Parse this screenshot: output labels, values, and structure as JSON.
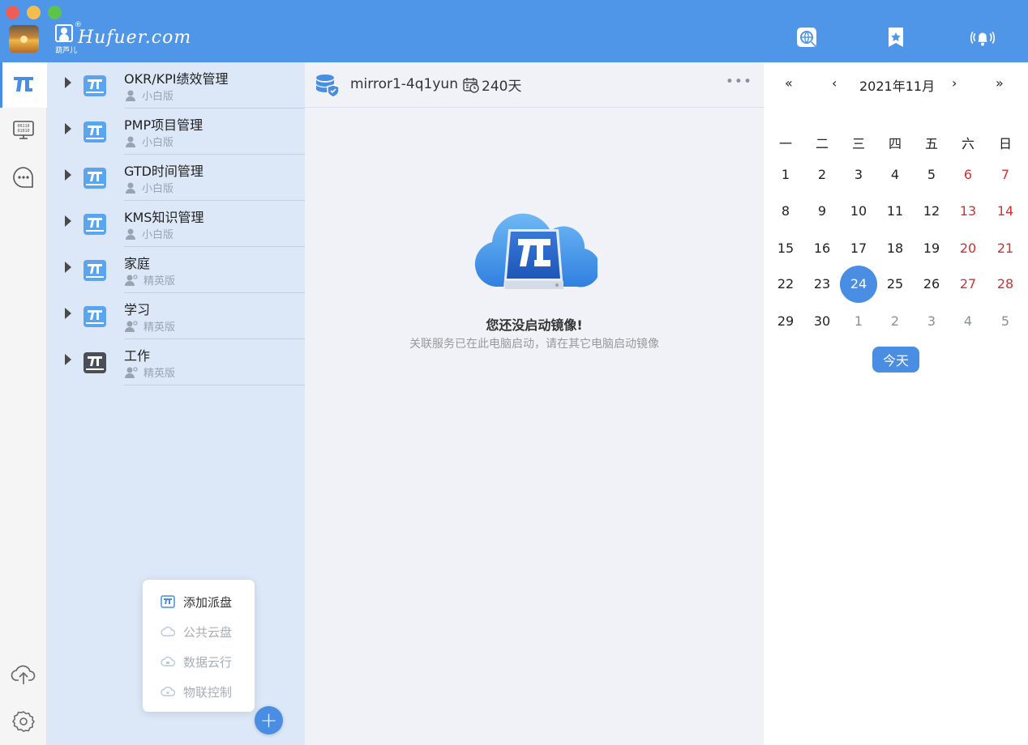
{
  "window": {
    "logo_text": "Hufuer.com",
    "logo_sub": "葫芦儿",
    "logo_reg": "®",
    "top_icons": [
      "globe-search-icon",
      "bookmark-star-icon",
      "bell-icon"
    ]
  },
  "rail": {
    "items": [
      "pi-disk-icon",
      "computer-code-icon",
      "chat-more-icon"
    ],
    "bottom_items": [
      "cloud-upload-icon",
      "settings-gear-icon"
    ]
  },
  "disks": [
    {
      "name": "OKR/KPI绩效管理",
      "edition": "小白版"
    },
    {
      "name": "PMP项目管理",
      "edition": "小白版"
    },
    {
      "name": "GTD时间管理",
      "edition": "小白版"
    },
    {
      "name": "KMS知识管理",
      "edition": "小白版"
    },
    {
      "name": "家庭",
      "edition": "精英版"
    },
    {
      "name": "学习",
      "edition": "精英版"
    },
    {
      "name": "工作",
      "edition": "精英版"
    }
  ],
  "popup": {
    "items": [
      {
        "label": "添加派盘",
        "enabled": true
      },
      {
        "label": "公共云盘",
        "enabled": false
      },
      {
        "label": "数据云行",
        "enabled": false
      },
      {
        "label": "物联控制",
        "enabled": false
      }
    ],
    "fab_label": "+"
  },
  "main": {
    "mirror_name": "mirror1-4q1yun",
    "days": "240天",
    "more": "•••",
    "empty_title": "您还没启动镜像!",
    "empty_desc": "关联服务已在此电脑启动，请在其它电脑启动镜像"
  },
  "calendar": {
    "title": "2021年11月",
    "nav": {
      "prev_year": "«",
      "prev_month": "‹",
      "next_month": "›",
      "next_year": "»"
    },
    "weekdays": [
      "一",
      "二",
      "三",
      "四",
      "五",
      "六",
      "日"
    ],
    "weeks": [
      [
        "1",
        "2",
        "3",
        "4",
        "5",
        "6",
        "7"
      ],
      [
        "8",
        "9",
        "10",
        "11",
        "12",
        "13",
        "14"
      ],
      [
        "15",
        "16",
        "17",
        "18",
        "19",
        "20",
        "21"
      ],
      [
        "22",
        "23",
        "24",
        "25",
        "26",
        "27",
        "28"
      ],
      [
        "29",
        "30",
        "1",
        "2",
        "3",
        "4",
        "5"
      ]
    ],
    "selected_day": "24",
    "today_label": "今天",
    "colors": {
      "accent": "#4a8ee4",
      "weekend": "#d42f2f"
    }
  }
}
